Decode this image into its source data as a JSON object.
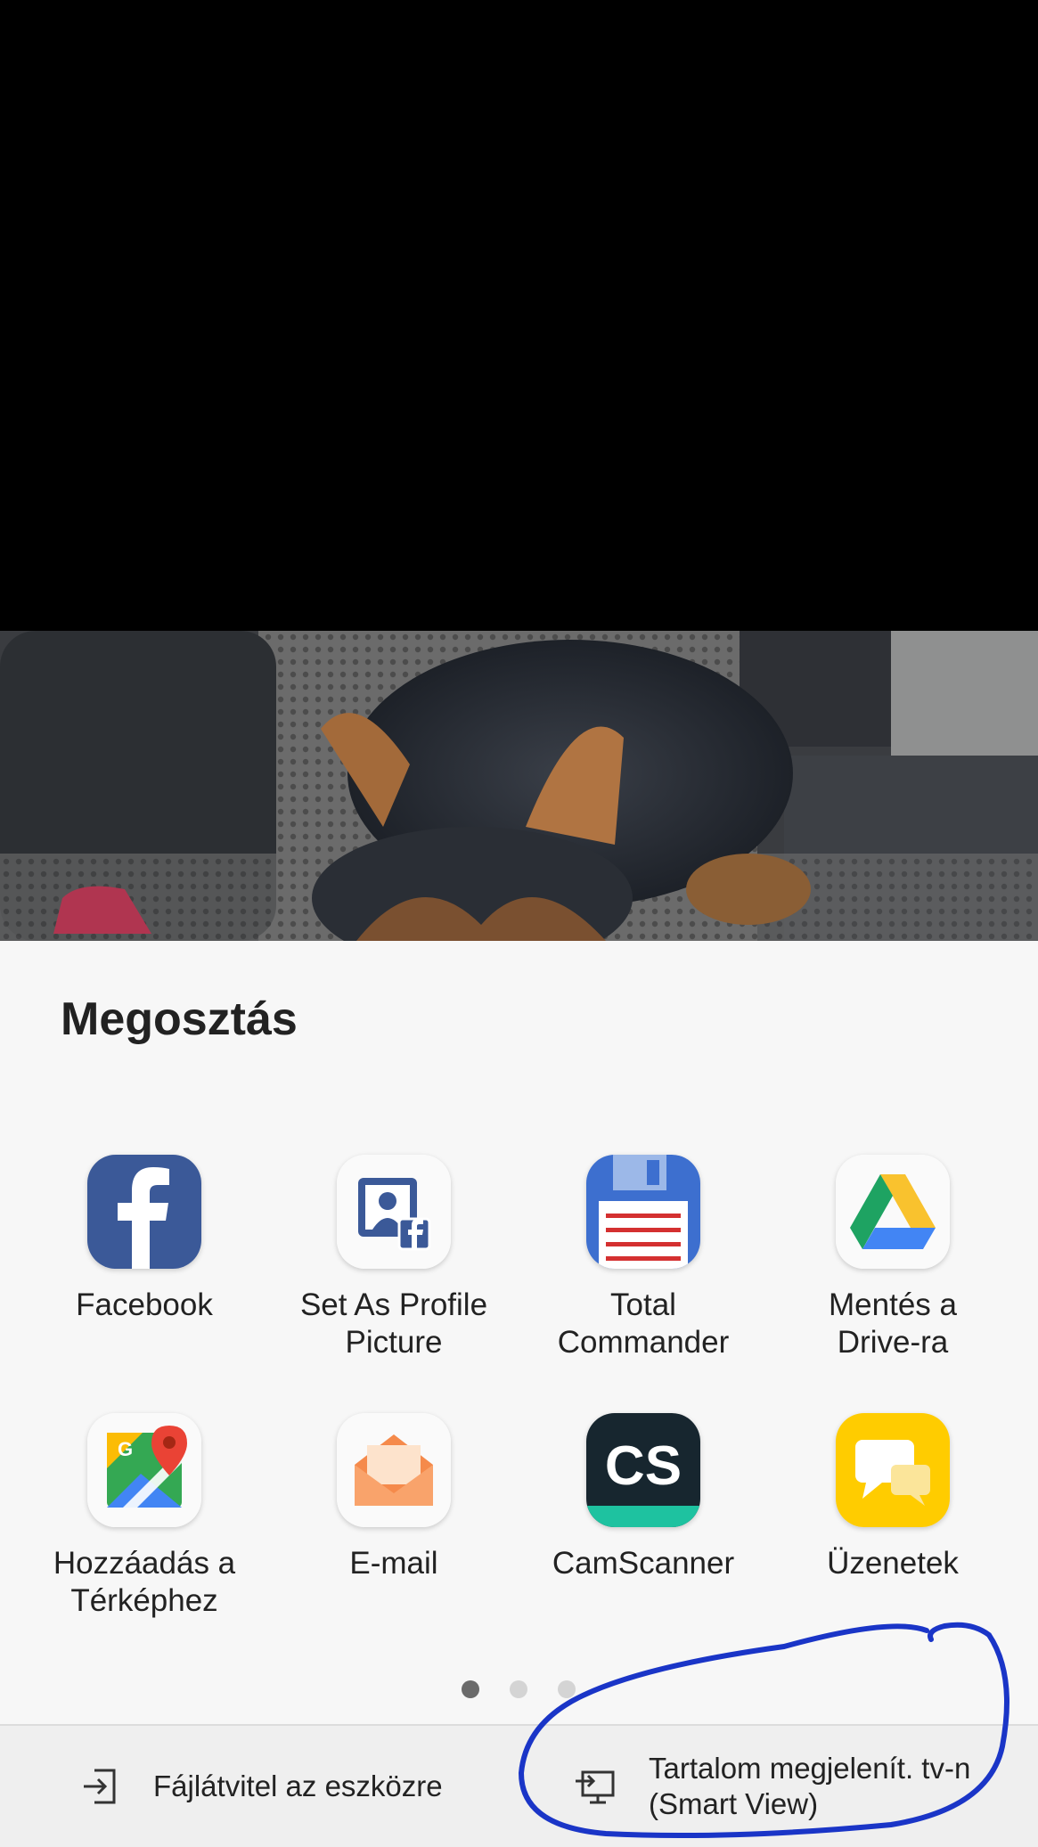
{
  "share_sheet": {
    "title": "Megosztás",
    "apps": [
      {
        "label": "Facebook",
        "icon": "facebook-icon"
      },
      {
        "label": "Set As Profile\nPicture",
        "icon": "profile-picture-icon"
      },
      {
        "label": "Total\nCommander",
        "icon": "floppy-disk-icon"
      },
      {
        "label": "Mentés a\nDrive-ra",
        "icon": "google-drive-icon"
      },
      {
        "label": "Hozzáadás a\nTérképhez",
        "icon": "google-maps-icon"
      },
      {
        "label": "E-mail",
        "icon": "envelope-icon"
      },
      {
        "label": "CamScanner",
        "icon": "camscanner-icon"
      },
      {
        "label": "Üzenetek",
        "icon": "chat-bubble-icon"
      }
    ],
    "camscanner_text": "CS",
    "page_count": 3,
    "current_page": 1
  },
  "bottom_bar": {
    "file_transfer": "Fájlátvitel az eszközre",
    "smart_view": "Tartalom megjelenít. tv-n\n(Smart View)"
  },
  "colors": {
    "facebook": "#3b5998",
    "total_commander": "#3d6fcf",
    "camscanner": "#17262f",
    "camscanner_accent": "#1ec2a0",
    "messages": "#ffcc00",
    "email": "#f9a36b",
    "annotation_ink": "#1a35c7"
  }
}
